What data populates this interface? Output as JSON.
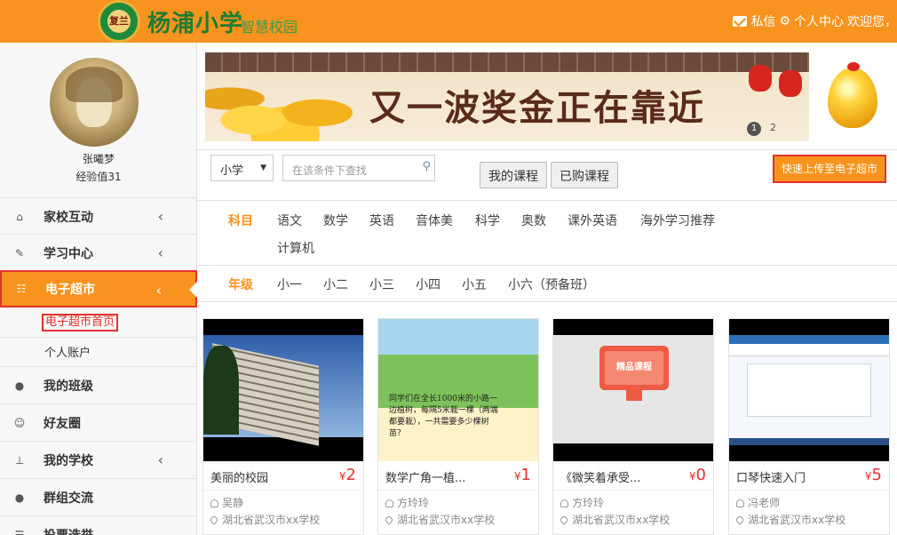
{
  "header": {
    "logo_seal_text": "复兰",
    "school_name": "杨浦小学",
    "subtitle": "智慧校园",
    "messages_label": "私信",
    "profile_label": "个人中心",
    "welcome": "欢迎您，"
  },
  "user": {
    "name": "张曦梦",
    "experience": "经验值31"
  },
  "sidebar": {
    "items": [
      {
        "label": "家校互动",
        "icon": "home-icon",
        "chevron": "‹"
      },
      {
        "label": "学习中心",
        "icon": "edit-icon",
        "chevron": "‹"
      },
      {
        "label": "电子超市",
        "icon": "cart-icon",
        "chevron": "‹"
      },
      {
        "label": "我的班级",
        "icon": "user-icon"
      },
      {
        "label": "好友圈",
        "icon": "smile-icon"
      },
      {
        "label": "我的学校",
        "icon": "sitemap-icon",
        "chevron": "‹"
      },
      {
        "label": "群组交流",
        "icon": "group-icon"
      },
      {
        "label": "投票选举",
        "icon": "vote-icon"
      }
    ],
    "sub_items": [
      {
        "label": "电子超市首页"
      },
      {
        "label": "个人账户"
      }
    ]
  },
  "banner": {
    "slogan": "又一波奖金正在靠近",
    "page_active": "1",
    "page_next": "2"
  },
  "filter": {
    "level_value": "小学",
    "search_placeholder": "在该条件下查找",
    "tab_my_courses": "我的课程",
    "tab_purchased": "已购课程",
    "quick_upload": "快速上传至电子超市"
  },
  "subjects": {
    "heading": "科目",
    "options": [
      "语文",
      "数学",
      "英语",
      "音体美",
      "科学",
      "奥数",
      "课外英语",
      "海外学习推荐",
      "计算机"
    ]
  },
  "grades": {
    "heading": "年级",
    "options": [
      "小一",
      "小二",
      "小三",
      "小四",
      "小五",
      "小六（预备班）"
    ]
  },
  "courses": [
    {
      "title": "美丽的校园",
      "price": "2",
      "author": "吴静",
      "school": "湖北省武汉市xx学校"
    },
    {
      "title": "数学广角一植...",
      "price": "1",
      "author": "方玲玲",
      "school": "湖北省武汉市xx学校"
    },
    {
      "title": "《微笑着承受...",
      "price": "0",
      "author": "方玲玲",
      "school": "湖北省武汉市xx学校"
    },
    {
      "title": "口琴快速入门",
      "price": "5",
      "author": "冯老师",
      "school": "湖北省武汉市xx学校"
    }
  ],
  "thumb_texts": {
    "card2_caption": "同学们在全长1000米的小路一边植树，每隔5米栽一棵（两端都要栽），一共需要多少棵树苗？",
    "card3_label": "精品课程"
  },
  "currency_symbol": "¥",
  "colors": {
    "brand_orange": "#f7931e",
    "brand_green": "#1d7d34",
    "highlight_red": "#e2322d"
  }
}
